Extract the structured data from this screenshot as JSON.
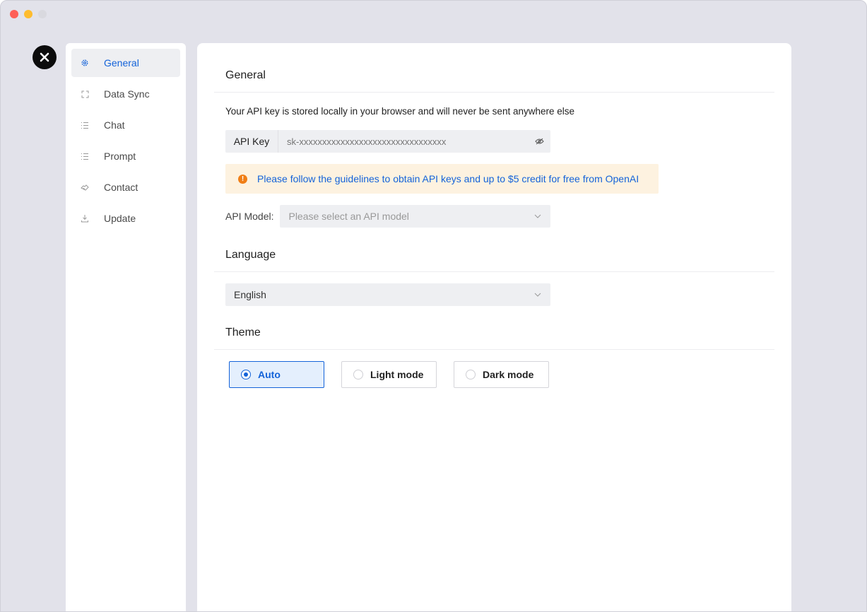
{
  "colors": {
    "accent": "#1463d9",
    "notice_bg": "#fdf2e0",
    "warning": "#f07e16",
    "window_bg": "#e2e2ea"
  },
  "sidebar": {
    "items": [
      {
        "label": "General",
        "icon": "gear-icon",
        "active": true
      },
      {
        "label": "Data Sync",
        "icon": "sync-icon",
        "active": false
      },
      {
        "label": "Chat",
        "icon": "list-icon",
        "active": false
      },
      {
        "label": "Prompt",
        "icon": "list-icon",
        "active": false
      },
      {
        "label": "Contact",
        "icon": "handshake-icon",
        "active": false
      },
      {
        "label": "Update",
        "icon": "download-icon",
        "active": false
      }
    ]
  },
  "general": {
    "title": "General",
    "description": "Your API key is stored locally in your browser and will never be sent anywhere else",
    "api_key_label": "API Key",
    "api_key_placeholder": "sk-xxxxxxxxxxxxxxxxxxxxxxxxxxxxxxxx",
    "notice": "Please follow the guidelines to obtain API keys and up to $5 credit for free from OpenAI",
    "api_model_label": "API Model:",
    "api_model_placeholder": "Please select an API model"
  },
  "language": {
    "title": "Language",
    "selected": "English"
  },
  "theme": {
    "title": "Theme",
    "options": [
      {
        "label": "Auto",
        "selected": true
      },
      {
        "label": "Light mode",
        "selected": false
      },
      {
        "label": "Dark mode",
        "selected": false
      }
    ]
  }
}
